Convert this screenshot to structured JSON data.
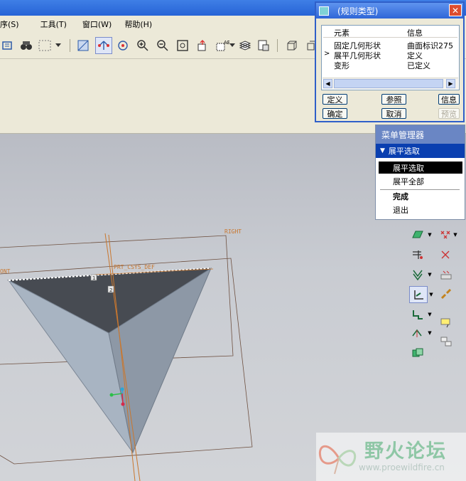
{
  "menubar": {
    "items": [
      "序(S)",
      "工具(T)",
      "窗口(W)",
      "帮助(H)"
    ]
  },
  "dialog": {
    "title": "(规则类型)",
    "columns": [
      "元素",
      "信息"
    ],
    "rows": [
      {
        "element": "固定几何形状",
        "info": "曲面标识275",
        "current": false
      },
      {
        "element": "展平几何形状",
        "info": "定义",
        "current": true
      },
      {
        "element": "变形",
        "info": "已定义",
        "current": false
      }
    ],
    "buttons": {
      "define": "定义",
      "reference": "参照",
      "info": "信息",
      "ok": "确定",
      "cancel": "取消",
      "preview": "预览"
    }
  },
  "menu_manager": {
    "title": "菜单管理器",
    "submenu": "展平选取",
    "items": [
      {
        "label": "展平选取",
        "selected": true,
        "bold": false
      },
      {
        "label": "展平全部",
        "selected": false,
        "bold": false
      },
      {
        "label": "完成",
        "selected": false,
        "bold": true
      },
      {
        "label": "退出",
        "selected": false,
        "bold": false
      }
    ]
  },
  "viewport": {
    "labels": {
      "right": "RIGHT",
      "front": "ONT",
      "csys": "PRT_CSYS_DEF",
      "marker_1": "1",
      "marker_2": "2"
    }
  },
  "watermark": {
    "title": "野火论坛",
    "url": "www.proewildfire.cn"
  },
  "colors": {
    "title_blue": "#2663d6",
    "menu_manager_header": "#6a86c4",
    "menu_manager_submenu": "#0a3fb0",
    "model_dark": "#484c53",
    "model_light": "#a6b2c0"
  }
}
